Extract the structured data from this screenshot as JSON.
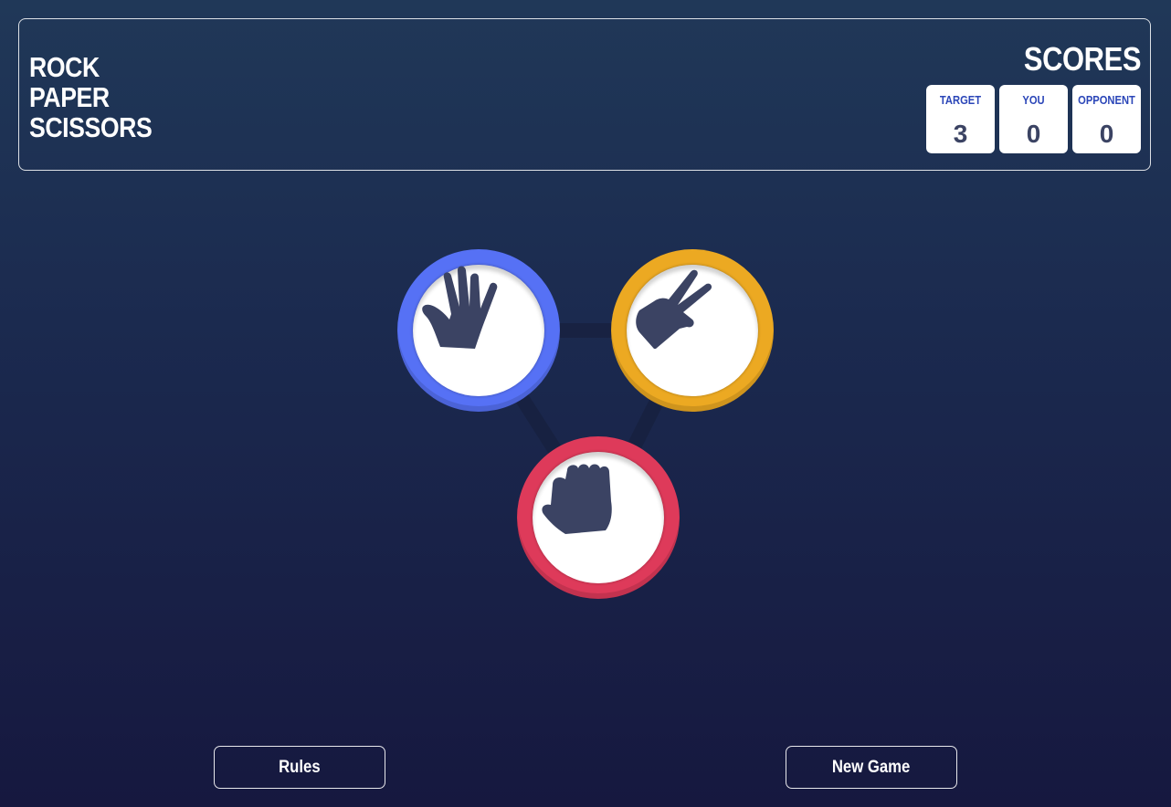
{
  "header": {
    "title_lines": [
      "ROCK",
      "PAPER",
      "SCISSORS"
    ],
    "scores_title": "SCORES",
    "scores": [
      {
        "label": "TARGET",
        "value": "3"
      },
      {
        "label": "YOU",
        "value": "0"
      },
      {
        "label": "OPPONENT",
        "value": "0"
      }
    ]
  },
  "tokens": [
    {
      "name": "paper",
      "icon": "paper-hand-icon",
      "color": "#5671f5"
    },
    {
      "name": "scissors",
      "icon": "scissors-hand-icon",
      "color": "#eca922"
    },
    {
      "name": "rock",
      "icon": "rock-fist-icon",
      "color": "#de3a5a"
    }
  ],
  "buttons": {
    "rules_label": "Rules",
    "new_game_label": "New Game"
  },
  "colors": {
    "background_top": "#203858",
    "background_bottom": "#16183f",
    "icon": "#3b4363",
    "score_label": "#2b46b8"
  }
}
